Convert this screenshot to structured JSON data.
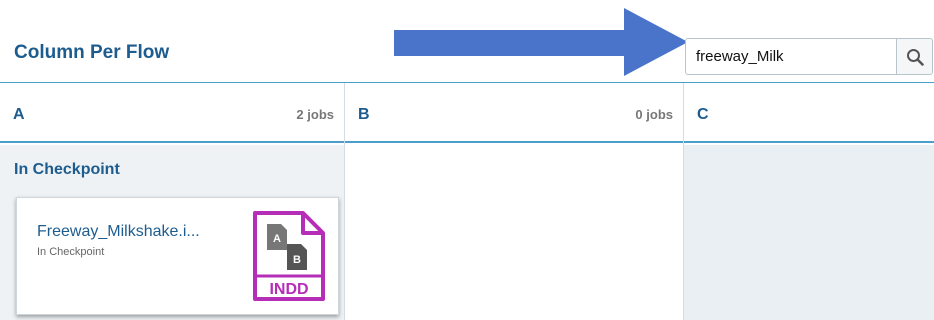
{
  "header": {
    "title": "Column Per Flow"
  },
  "search": {
    "value": "freeway_Milk",
    "icon": "search-icon"
  },
  "annotation": {
    "arrow_color": "#4a74c9",
    "icon": "arrow-right-icon"
  },
  "columns": [
    {
      "label": "A",
      "count": "2 jobs"
    },
    {
      "label": "B",
      "count": "0 jobs"
    },
    {
      "label": "C",
      "count": ""
    }
  ],
  "sections": [
    {
      "title": "In Checkpoint",
      "jobs": [
        {
          "name": "Freeway_Milkshake.i...",
          "status": "In Checkpoint",
          "file_type": "INDD",
          "glyph_a": "A",
          "glyph_b": "B",
          "icon": "indd-file-icon",
          "icon_color": "#b62db8"
        }
      ]
    }
  ],
  "colors": {
    "accent": "#1d5c8f",
    "rule": "#4a9fcf",
    "panel": "#eaeff3"
  }
}
